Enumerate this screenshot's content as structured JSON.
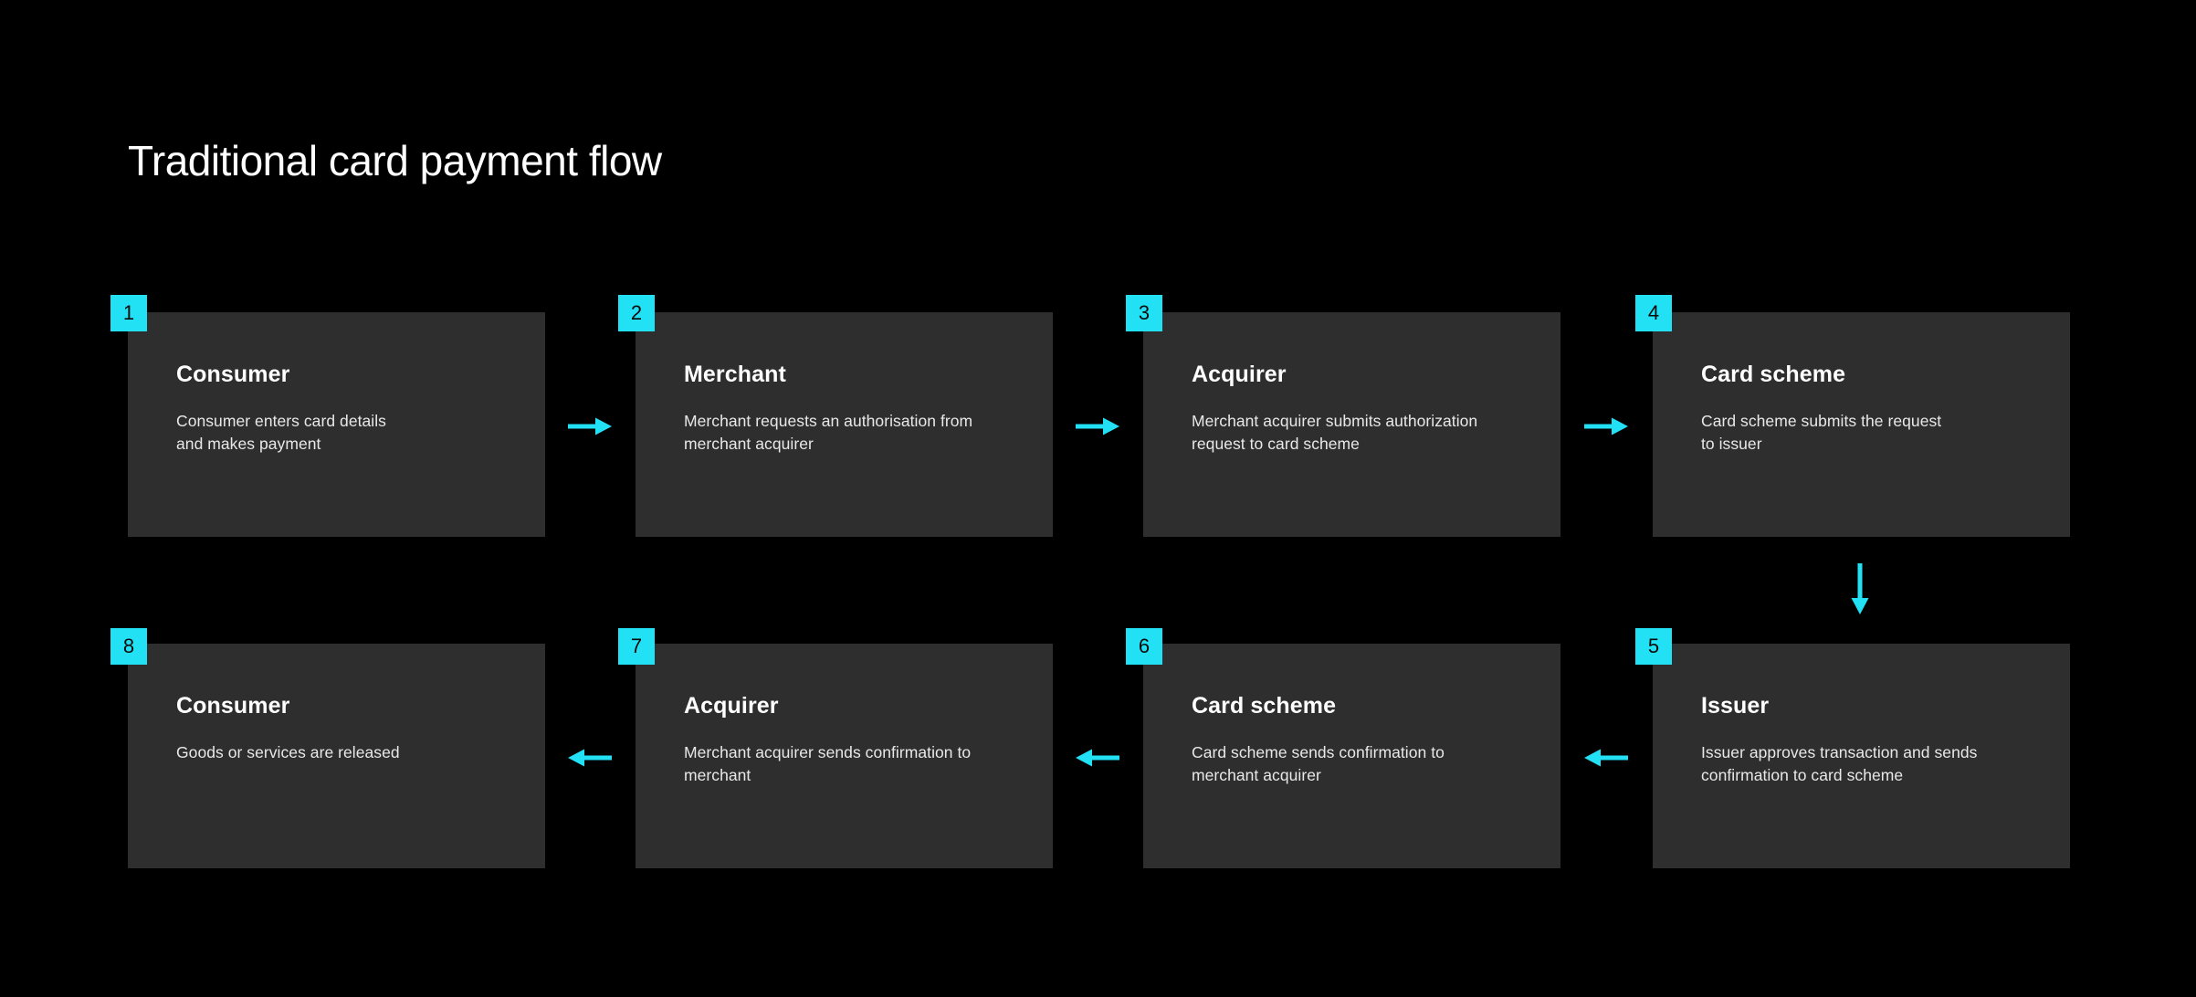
{
  "page": {
    "title": "Traditional card payment flow",
    "background_color": "#000000",
    "card_color": "#2e2e2e",
    "accent_color": "#22e1f5"
  },
  "flow": {
    "steps": [
      {
        "number": "1",
        "title": "Consumer",
        "description": "Consumer enters card details\nand makes payment"
      },
      {
        "number": "2",
        "title": "Merchant",
        "description": "Merchant requests an authorisation from\nmerchant acquirer"
      },
      {
        "number": "3",
        "title": "Acquirer",
        "description": "Merchant acquirer submits authorization\nrequest to card scheme"
      },
      {
        "number": "4",
        "title": "Card scheme",
        "description": "Card scheme submits the request\nto issuer"
      },
      {
        "number": "5",
        "title": "Issuer",
        "description": "Issuer approves transaction and sends\nconfirmation to card scheme"
      },
      {
        "number": "6",
        "title": "Card scheme",
        "description": "Card scheme sends confirmation to\nmerchant acquirer"
      },
      {
        "number": "7",
        "title": "Acquirer",
        "description": "Merchant acquirer sends confirmation to\nmerchant"
      },
      {
        "number": "8",
        "title": "Consumer",
        "description": "Goods or services are released"
      }
    ],
    "connectors": [
      {
        "direction": "right",
        "from": "1",
        "to": "2"
      },
      {
        "direction": "right",
        "from": "2",
        "to": "3"
      },
      {
        "direction": "right",
        "from": "3",
        "to": "4"
      },
      {
        "direction": "down",
        "from": "4",
        "to": "5"
      },
      {
        "direction": "left",
        "from": "5",
        "to": "6"
      },
      {
        "direction": "left",
        "from": "6",
        "to": "7"
      },
      {
        "direction": "left",
        "from": "7",
        "to": "8"
      }
    ]
  }
}
